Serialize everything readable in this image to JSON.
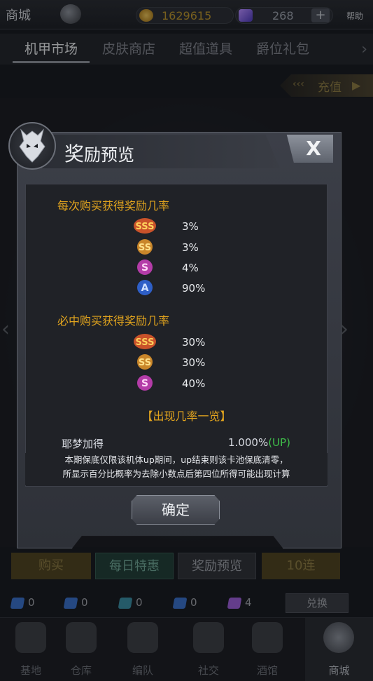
{
  "topbar": {
    "title": "商城",
    "gold_amount": "1629615",
    "gem_amount": "268",
    "plus_label": "+",
    "help_label": "帮助"
  },
  "tabs": [
    {
      "label": "机甲市场",
      "active": true
    },
    {
      "label": "皮肤商店",
      "active": false
    },
    {
      "label": "超值道具",
      "active": false
    },
    {
      "label": "爵位礼包",
      "active": false
    }
  ],
  "recharge_label": "充值",
  "modal": {
    "title_first": "奖",
    "title_rest": "励预览",
    "close_label": "X",
    "section1_title": "每次购买获得奖励几率",
    "section1_rates": [
      {
        "grade": "SSS",
        "pct": "3%"
      },
      {
        "grade": "SS",
        "pct": "3%"
      },
      {
        "grade": "S",
        "pct": "4%"
      },
      {
        "grade": "A",
        "pct": "90%"
      }
    ],
    "section2_title": "必中购买获得奖励几率",
    "section2_rates": [
      {
        "grade": "SSS",
        "pct": "30%"
      },
      {
        "grade": "SS",
        "pct": "30%"
      },
      {
        "grade": "S",
        "pct": "40%"
      }
    ],
    "list_title": "【出现几率一览】",
    "extra_name": "耶梦加得",
    "extra_pct": "1.000%",
    "extra_up": "(UP)",
    "note_line1": "本期保底仅限该机体up期间，up结束则该卡池保底清零，",
    "note_line2": "所显示百分比概率为去除小数点后第四位所得可能出现计算",
    "confirm_label": "确定"
  },
  "actions": {
    "buy": "购买",
    "daily": "每日特惠",
    "preview": "奖励预览",
    "ten": "10连"
  },
  "items": [
    {
      "count": "0",
      "color": "#3a6fc7"
    },
    {
      "count": "0",
      "color": "#3a6fc7"
    },
    {
      "count": "0",
      "color": "#3a8ba0"
    },
    {
      "count": "0",
      "color": "#3a6fc7"
    },
    {
      "count": "4",
      "color": "#9a5fd6"
    }
  ],
  "exchange_label": "兑换",
  "nav": [
    {
      "label": "基地",
      "icon": "base-icon",
      "active": false
    },
    {
      "label": "仓库",
      "icon": "warehouse-icon",
      "active": false
    },
    {
      "label": "编队",
      "icon": "formation-icon",
      "active": false
    },
    {
      "label": "社交",
      "icon": "handshake-icon",
      "active": false
    },
    {
      "label": "酒馆",
      "icon": "tavern-icon",
      "active": false
    },
    {
      "label": "商城",
      "icon": "shop-icon",
      "active": true
    }
  ],
  "colors": {
    "accent_gold": "#e3a51e",
    "up_green": "#3fc04a"
  }
}
